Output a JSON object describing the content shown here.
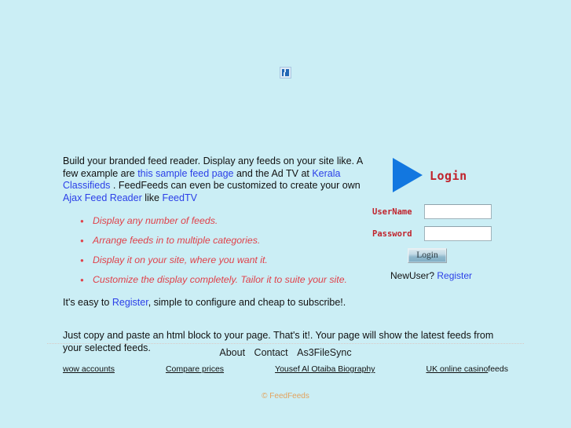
{
  "page": {
    "background_color": "#cbeef5",
    "link_color": "#2b3fe8",
    "accent_red": "#e0414a",
    "copyright_color": "#e3a25c"
  },
  "header": {
    "logo_alt": "broken-image-placeholder"
  },
  "intro": {
    "seg1": "Build your branded feed reader. Display any feeds on your site like. A few example are ",
    "link1": "this sample feed page",
    "seg2": " and the Ad TV at ",
    "link2": "Kerala Classifieds",
    "seg3": " . FeedFeeds can even be customized to create your own ",
    "link3": "Ajax Feed Reader",
    "seg4": " like ",
    "link4": "FeedTV"
  },
  "features": [
    "Display any number of feeds.",
    "Arrange feeds in to multiple categories.",
    "Display it on your site, where you want it.",
    "Customize the display completely. Tailor it to suite your site."
  ],
  "tail": {
    "seg1": "It's easy to ",
    "link1": "Register",
    "seg2": ", simple to configure and cheap to subscribe!.",
    "para2": "Just copy and paste an html block to your page. That's it!. Your page will show the latest feeds from your selected feeds."
  },
  "login": {
    "title": "Login",
    "username_label": "UserName",
    "password_label": "Password",
    "username_value": "",
    "password_value": "",
    "username_placeholder": "",
    "password_placeholder": "",
    "submit_label": "Login",
    "newuser_text": "NewUser? ",
    "register_link": "Register"
  },
  "footer": {
    "nav": [
      "About",
      "Contact",
      "As3FileSync"
    ],
    "links": [
      {
        "label": "wow accounts",
        "underlined": true
      },
      {
        "label": "Compare prices",
        "underlined": true
      },
      {
        "label": "Yousef Al Otaiba Biography",
        "underlined": true
      },
      {
        "label": "UK online casino",
        "underlined": true
      },
      {
        "label": "feeds",
        "underlined": false
      }
    ],
    "copyright": "© FeedFeeds"
  }
}
